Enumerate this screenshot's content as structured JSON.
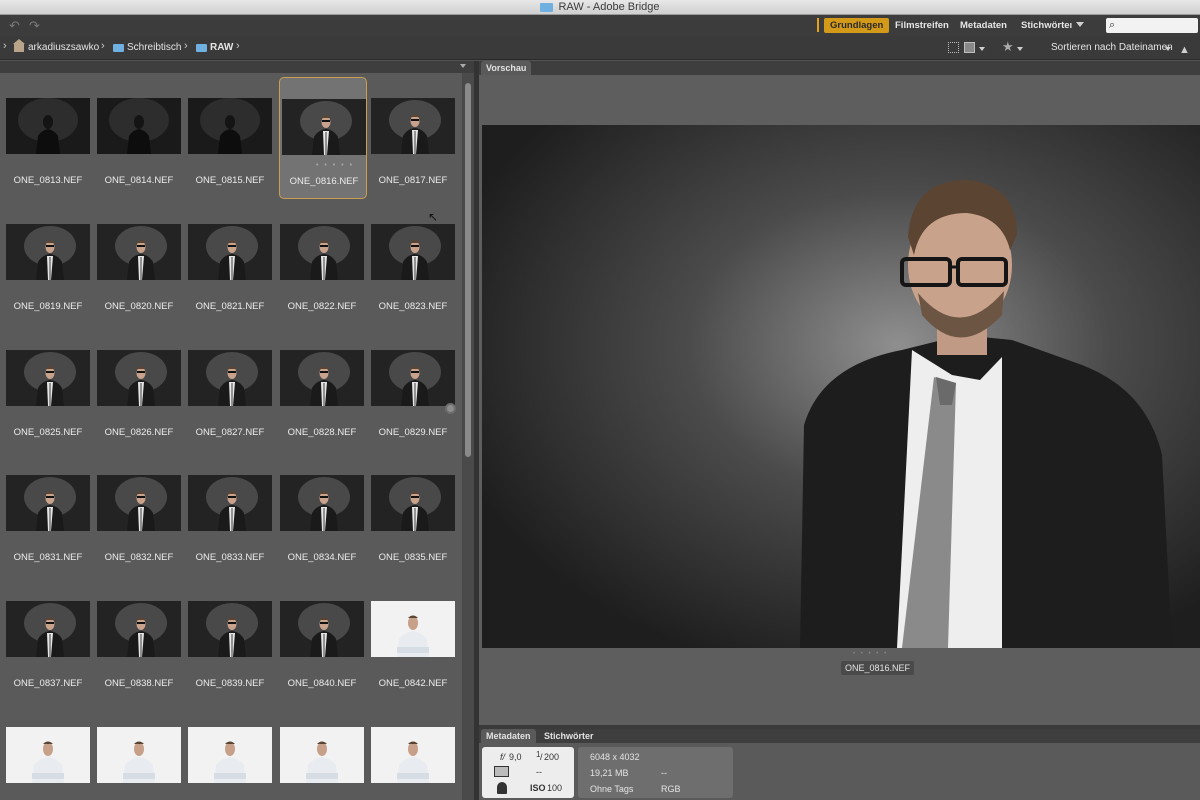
{
  "window": {
    "title": "RAW - Adobe Bridge"
  },
  "workspaces": [
    {
      "label": "Grundlagen",
      "active": true
    },
    {
      "label": "Filmstreifen",
      "active": false
    },
    {
      "label": "Metadaten",
      "active": false
    },
    {
      "label": "Stichwörteı",
      "active": false
    }
  ],
  "breadcrumb": {
    "items": [
      "arkadiuszsawko",
      "Schreibtisch",
      "RAW"
    ]
  },
  "sort": {
    "label": "Sortieren nach Dateinamen"
  },
  "content": {
    "files": [
      "ONE_0813.NEF",
      "ONE_0814.NEF",
      "ONE_0815.NEF",
      "ONE_0816.NEF",
      "ONE_0817.NEF",
      "ONE_0819.NEF",
      "ONE_0820.NEF",
      "ONE_0821.NEF",
      "ONE_0822.NEF",
      "ONE_0823.NEF",
      "ONE_0825.NEF",
      "ONE_0826.NEF",
      "ONE_0827.NEF",
      "ONE_0828.NEF",
      "ONE_0829.NEF",
      "ONE_0831.NEF",
      "ONE_0832.NEF",
      "ONE_0833.NEF",
      "ONE_0834.NEF",
      "ONE_0835.NEF",
      "ONE_0837.NEF",
      "ONE_0838.NEF",
      "ONE_0839.NEF",
      "ONE_0840.NEF",
      "ONE_0842.NEF"
    ],
    "selected_index": 3
  },
  "preview": {
    "tab_label": "Vorschau",
    "filename": "ONE_0816.NEF"
  },
  "metadata": {
    "tabs": [
      "Metadaten",
      "Stichwörter"
    ],
    "aperture": "9,0",
    "shutter_num": "1",
    "shutter_den": "200",
    "exposure_comp": "--",
    "iso_label": "ISO",
    "iso_value": "100",
    "dimensions": "6048 x 4032",
    "size": "19,21 MB",
    "size_extra": "--",
    "tags": "Ohne Tags",
    "color_mode": "RGB"
  },
  "colors": {
    "accent": "#d39a19",
    "panel": "#5a5a5a",
    "toolbar": "#3c3c3c"
  }
}
